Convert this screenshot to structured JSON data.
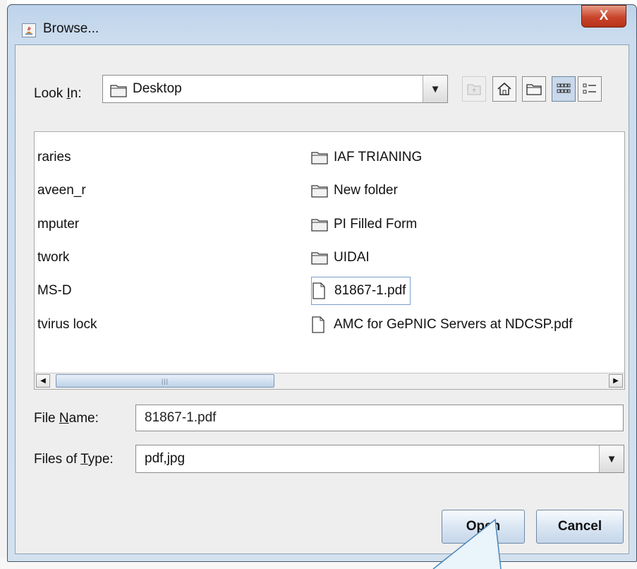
{
  "window": {
    "title": "Browse...",
    "close_label": "X"
  },
  "look_in": {
    "label": "Look In:",
    "value": "Desktop"
  },
  "toolbar_icons": [
    "up-folder-icon",
    "home-icon",
    "new-folder-icon",
    "list-view-icon",
    "details-view-icon"
  ],
  "file_list": {
    "left_column": [
      {
        "name": "raries"
      },
      {
        "name": "aveen_r"
      },
      {
        "name": "mputer"
      },
      {
        "name": "twork"
      },
      {
        "name": "MS-D"
      },
      {
        "name": "tvirus lock"
      }
    ],
    "right_column": [
      {
        "name": "IAF TRIANING",
        "type": "folder"
      },
      {
        "name": "New folder",
        "type": "folder"
      },
      {
        "name": "PI Filled Form",
        "type": "folder"
      },
      {
        "name": "UIDAI",
        "type": "folder"
      },
      {
        "name": "81867-1.pdf",
        "type": "file",
        "selected": true
      },
      {
        "name": "AMC for GePNIC Servers at NDCSP.pdf",
        "type": "file"
      }
    ]
  },
  "file_name": {
    "label": "File Name:",
    "value": "81867-1.pdf"
  },
  "file_type": {
    "label": "Files of Type:",
    "value": "pdf,jpg"
  },
  "buttons": {
    "open": "Open",
    "cancel": "Cancel"
  },
  "colors": {
    "title_gradient": "#cbdcee",
    "close_button": "#c8452b",
    "selection_border": "#7a9ccb",
    "button_gradient": "#dae6f3"
  }
}
